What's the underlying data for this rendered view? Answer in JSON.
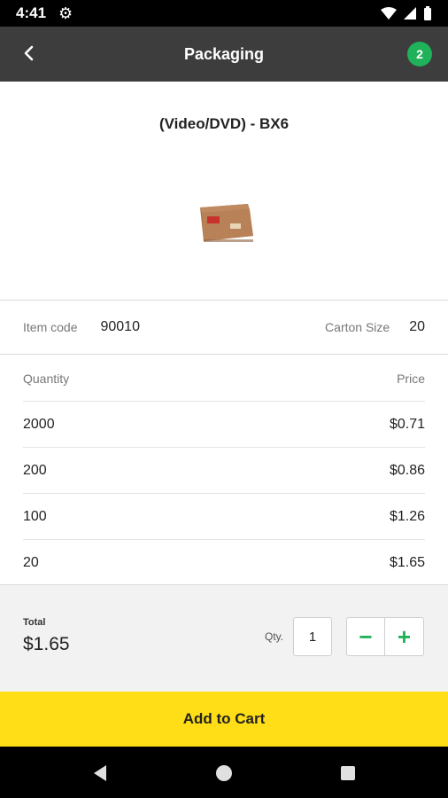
{
  "status_bar": {
    "time": "4:41"
  },
  "app_bar": {
    "title": "Packaging",
    "cart_count": "2"
  },
  "product": {
    "name": "(Video/DVD) - BX6"
  },
  "specs": {
    "item_code_label": "Item code",
    "item_code": "90010",
    "carton_size_label": "Carton Size",
    "carton_size": "20"
  },
  "pricing": {
    "quantity_header": "Quantity",
    "price_header": "Price",
    "rows": [
      {
        "quantity": "2000",
        "price": "$0.71"
      },
      {
        "quantity": "200",
        "price": "$0.86"
      },
      {
        "quantity": "100",
        "price": "$1.26"
      },
      {
        "quantity": "20",
        "price": "$1.65"
      }
    ]
  },
  "footer": {
    "total_label": "Total",
    "total_value": "$1.65",
    "qty_label": "Qty.",
    "qty_value": "1",
    "minus": "−",
    "plus": "+"
  },
  "cta": {
    "label": "Add to Cart"
  },
  "colors": {
    "app_bar": "#3d3d3d",
    "accent_green": "#1fb25a",
    "cta_yellow": "#ffdd17"
  }
}
